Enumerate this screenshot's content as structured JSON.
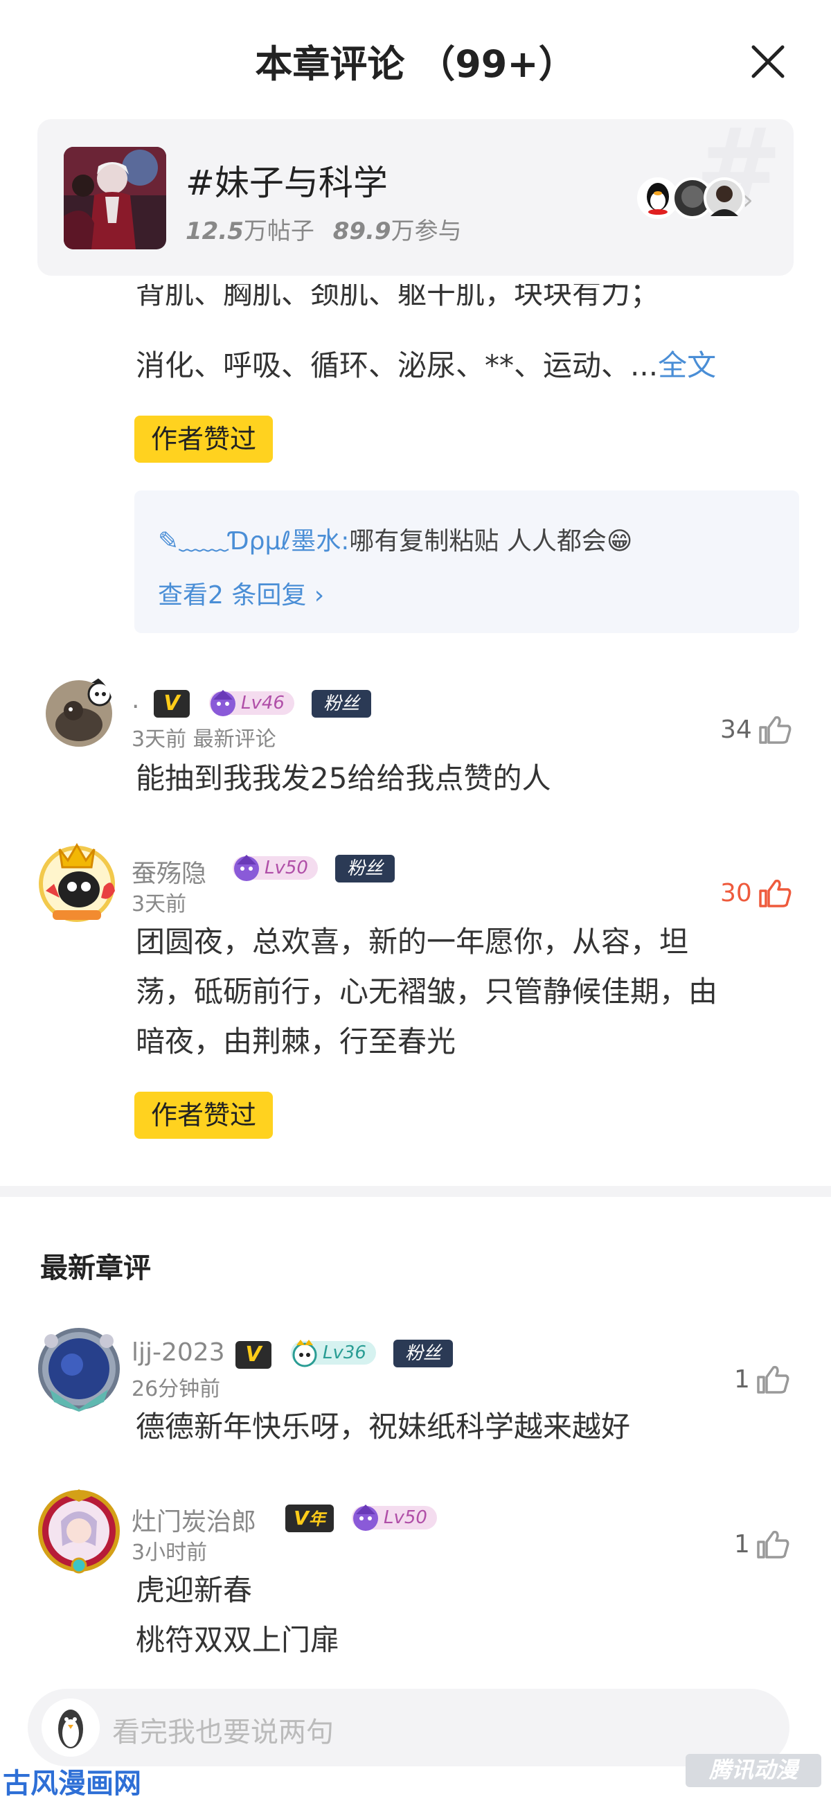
{
  "header": {
    "title": "本章评论 （99+）"
  },
  "topic": {
    "name": "#妹子与科学",
    "posts_num": "12.5",
    "posts_unit": "万帖子",
    "participants_num": "89.9",
    "participants_unit": "万参与"
  },
  "top_comment": {
    "clipped_line": "背肌、胸肌、颈肌、躯干肌，块块有力；",
    "line2": "消化、呼吸、循环、泌尿、**、运动、...",
    "full_text_link": "全文",
    "author_liked": "作者赞过",
    "reply_preview": {
      "name": "✎﹏﹏Ɗρμℓ墨水:",
      "text": "哪有复制粘贴 人人都会😁"
    },
    "view_replies": "查看2 条回复 ›"
  },
  "comments": [
    {
      "username": ".",
      "level": "Lv46",
      "fan": "粉丝",
      "meta": "3天前 最新评论",
      "likes": "34",
      "text": "能抽到我我发25给给我点赞的人"
    },
    {
      "username": "蚕殇隐",
      "level": "Lv50",
      "fan": "粉丝",
      "meta": "3天前",
      "likes": "30",
      "text_lines": [
        "团圆夜，总欢喜，新的一年愿你，从容，坦",
        "荡，砥砺前行，心无褶皱，只管静候佳期，由",
        "暗夜，由荆棘，行至春光"
      ],
      "author_liked": "作者赞过"
    }
  ],
  "latest_section": {
    "title": "最新章评"
  },
  "latest_comments": [
    {
      "username": "ljj-2023",
      "level": "Lv36",
      "fan": "粉丝",
      "meta": "26分钟前",
      "likes": "1",
      "text": "德德新年快乐呀，祝妹纸科学越来越好"
    },
    {
      "username": "灶门炭治郎",
      "vip_year": "年",
      "level": "Lv50",
      "meta": "3小时前",
      "likes": "1",
      "text_lines": [
        "虎迎新春",
        "桃符双双上门扉"
      ]
    }
  ],
  "bottom_bar": {
    "placeholder": "看完我也要说两句"
  },
  "watermark": {
    "left": "古风漫画网",
    "right": "腾讯动漫"
  },
  "colors": {
    "accent_blue": "#4a8ed6",
    "like_red": "#ee5a3c",
    "badge_yellow": "#ffd21f"
  }
}
